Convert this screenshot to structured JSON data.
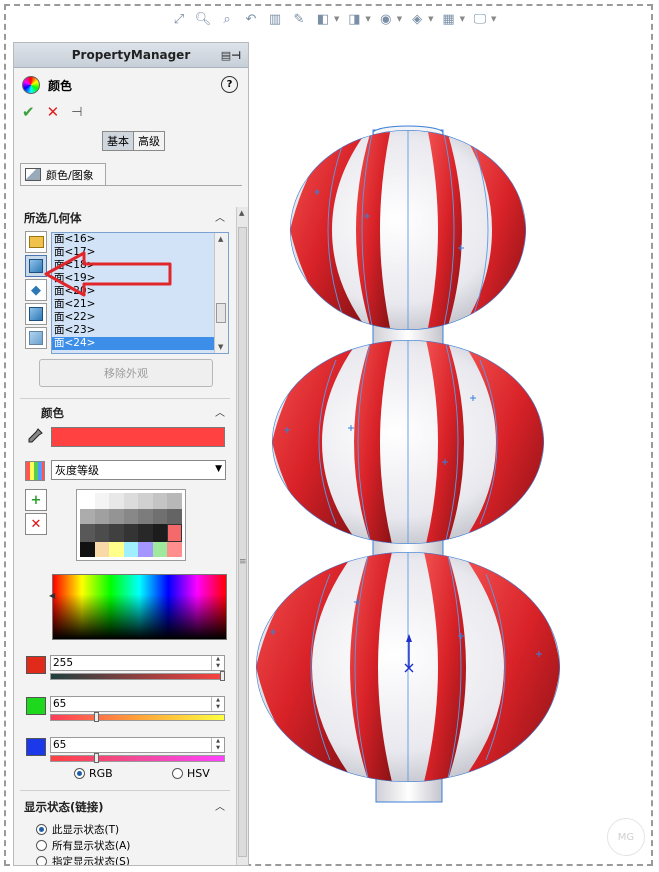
{
  "panel": {
    "header_title": "PropertyManager",
    "feature_title": "颜色",
    "help_label": "?",
    "mode_tabs": [
      "基本",
      "高级"
    ],
    "subtab_label": "颜色/图象"
  },
  "selected_geometry": {
    "title": "所选几何体",
    "faces": [
      "面<16>",
      "面<17>",
      "面<18>",
      "面<19>",
      "面<20>",
      "面<21>",
      "面<22>",
      "面<23>",
      "面<24>"
    ],
    "selected_face": "面<24>",
    "remove_button": "移除外观"
  },
  "color": {
    "title": "颜色",
    "current_hex": "#ff4141",
    "palette_select": "灰度等级",
    "rgb": {
      "r": "255",
      "g": "65",
      "b": "65"
    },
    "slider_fraction": {
      "r": 1.0,
      "g": 0.255,
      "b": 0.255
    },
    "mode_rgb": "RGB",
    "mode_hsv": "HSV",
    "mode_selected": "RGB"
  },
  "display_state": {
    "title": "显示状态(链接)",
    "options": [
      "此显示状态(T)",
      "所有显示状态(A)",
      "指定显示状态(S)"
    ],
    "selected": 0
  },
  "icons": {
    "ok": "✔",
    "cancel": "✕",
    "pin": "⊣",
    "collapse": "︿",
    "eyedropper": "eyedropper-icon"
  },
  "watermark_text": "MG",
  "colors": {
    "accent_red": "#ff4141",
    "lantern_red": "#d8262b",
    "edge_blue": "#3a7fd8",
    "selection_blue": "#3c8ee8"
  }
}
